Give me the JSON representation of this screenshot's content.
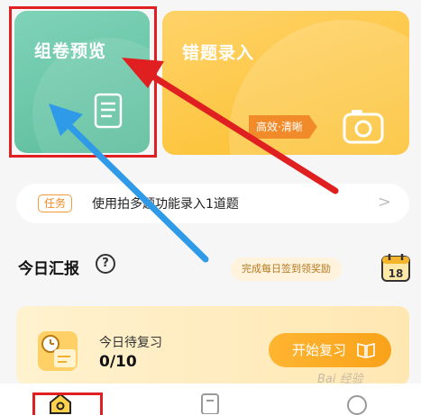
{
  "cards": {
    "preview": {
      "title": "组卷预览"
    },
    "wrong": {
      "title": "错题录入",
      "badge": "高效·清晰"
    }
  },
  "task": {
    "tag": "任务",
    "text": "使用拍多题功能录入1道题",
    "arrow": ">"
  },
  "report": {
    "title": "今日汇报",
    "help": "?",
    "signin": "完成每日签到领奖励",
    "calendar_day": "18"
  },
  "review": {
    "label": "今日待复习",
    "value": "0/10",
    "button": "开始复习"
  },
  "watermark": "Bai 经验",
  "colors": {
    "accent_orange": "#fbbf2a",
    "accent_green": "#5cbd9c",
    "annotation_red": "#e02020",
    "annotation_blue": "#2f9ae8"
  }
}
